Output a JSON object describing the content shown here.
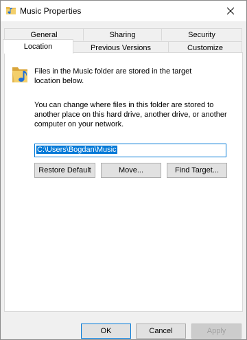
{
  "window": {
    "title": "Music Properties"
  },
  "tabs": {
    "row1": [
      "General",
      "Sharing",
      "Security"
    ],
    "row2": [
      "Location",
      "Previous Versions",
      "Customize"
    ],
    "active": "Location"
  },
  "location": {
    "description": "Files in the Music folder are stored in the target location below.",
    "help_text": "You can change where files in this folder are stored to another place on this hard drive, another drive, or another computer on your network.",
    "path_value": "C:\\Users\\Bogdan\\Music",
    "restore_default_label": "Restore Default",
    "move_label": "Move...",
    "find_target_label": "Find Target..."
  },
  "footer": {
    "ok_label": "OK",
    "cancel_label": "Cancel",
    "apply_label": "Apply"
  },
  "icons": {
    "title": "music-folder-icon",
    "folder": "music-folder-icon",
    "close": "close-icon"
  },
  "colors": {
    "accent": "#0078d7",
    "folder_yellow": "#e8b84a",
    "note_blue": "#1e6fd9"
  }
}
